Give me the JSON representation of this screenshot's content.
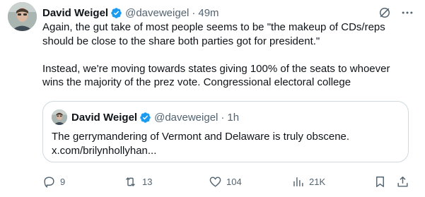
{
  "tweet": {
    "author_name": "David Weigel",
    "handle": "@daveweigel",
    "separator": "·",
    "time": "49m",
    "paragraphs": [
      "Again, the gut take of most people seems to be \"the makeup of CDs/reps should be close to the share both parties got for president.\"",
      "Instead, we're moving towards states giving 100% of the seats to whoever wins the majority of the prez vote. Congressional electoral college"
    ]
  },
  "quoted": {
    "author_name": "David Weigel",
    "handle": "@daveweigel",
    "separator": "·",
    "time": "1h",
    "text_line1": "The gerrymandering of Vermont and Delaware is truly obscene.",
    "text_line2": "x.com/brilynhollyhan..."
  },
  "actions": {
    "replies": "9",
    "reposts": "13",
    "likes": "104",
    "views": "21K"
  },
  "icons": [
    "grok-icon",
    "more-icon",
    "reply-icon",
    "repost-icon",
    "like-icon",
    "views-icon",
    "bookmark-icon",
    "share-icon",
    "verified-badge-icon"
  ],
  "colors": {
    "verified": "#1d9bf0",
    "muted": "#536471",
    "text": "#0f1419",
    "border": "#cfd9de"
  }
}
